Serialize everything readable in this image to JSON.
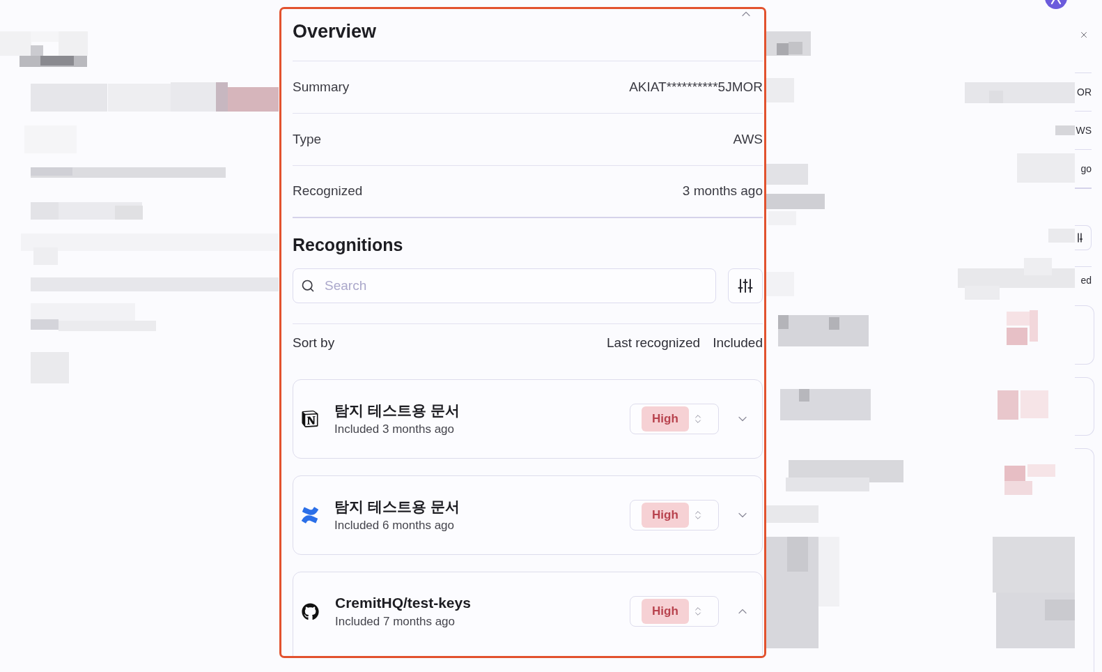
{
  "overview": {
    "title": "Overview",
    "fields": [
      {
        "label": "Summary",
        "value": "AKIAT**********5JMOR"
      },
      {
        "label": "Type",
        "value": "AWS"
      },
      {
        "label": "Recognized",
        "value": "3 months ago"
      }
    ]
  },
  "recognitions": {
    "title": "Recognitions",
    "search": {
      "placeholder": "Search"
    },
    "sort": {
      "label": "Sort by",
      "options": [
        "Last recognized",
        "Included"
      ]
    },
    "items": [
      {
        "kind": "notion",
        "title": "탐지 테스트용 문서",
        "subtitle": "Included 3 months ago",
        "severity": "High",
        "expanded": false
      },
      {
        "kind": "confluence",
        "title": "탐지 테스트용 문서",
        "subtitle": "Included 6 months ago",
        "severity": "High",
        "expanded": false
      },
      {
        "kind": "github",
        "title": "CremitHQ/test-keys",
        "subtitle": "Included 7 months ago",
        "severity": "High",
        "expanded": true
      }
    ]
  },
  "side_panel": {
    "cut_texts": [
      "OR",
      "WS",
      "go",
      "ed"
    ]
  }
}
